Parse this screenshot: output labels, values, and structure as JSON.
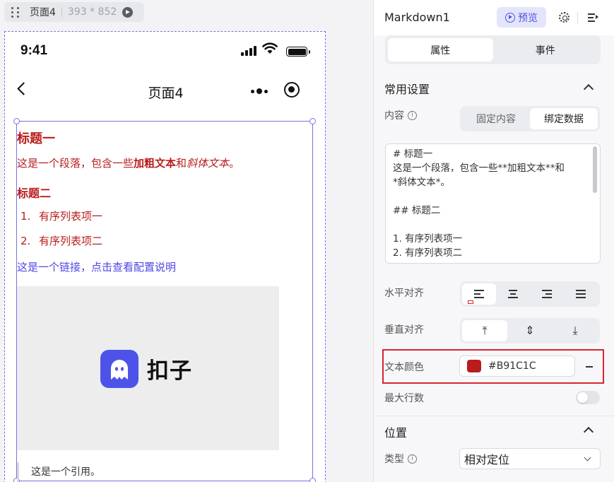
{
  "canvas": {
    "page_name": "页面4",
    "page_size": "393 * 852",
    "phone": {
      "time": "9:41",
      "nav_title": "页面4"
    },
    "markdown": {
      "h1": "标题一",
      "p_before": "这是一个段落，包含一些",
      "p_bold": "加粗文本",
      "p_mid": "和",
      "p_italic": "斜体文本",
      "p_end": "。",
      "h2": "标题二",
      "list": [
        {
          "num": "1.",
          "text": "有序列表项一"
        },
        {
          "num": "2.",
          "text": "有序列表项二"
        }
      ],
      "link": "这是一个链接，点击查看配置说明",
      "image_logo_text": "扣子",
      "quote": "这是一个引用。"
    }
  },
  "panel": {
    "component_name": "Markdown1",
    "preview_label": "预览",
    "tabs": [
      "属性",
      "事件"
    ],
    "active_tab": "属性",
    "section_common": "常用设置",
    "content_label": "内容",
    "content_modes": [
      "固定内容",
      "绑定数据"
    ],
    "content_mode_active": "绑定数据",
    "content_text": "# 标题一\n这是一个段落，包含一些**加粗文本**和\n*斜体文本*。\n\n## 标题二\n\n1. 有序列表项一\n2. 有序列表项二",
    "h_align_label": "水平对齐",
    "v_align_label": "垂直对齐",
    "text_color_label": "文本颜色",
    "text_color_value": "#B91C1C",
    "max_lines_label": "最大行数",
    "section_position": "位置",
    "type_label": "类型",
    "type_value": "相对定位"
  },
  "colors": {
    "accent": "#4d53e8",
    "markdown_text": "#B91C1C",
    "link": "#4f46e5",
    "highlight_border": "#d8242e"
  }
}
